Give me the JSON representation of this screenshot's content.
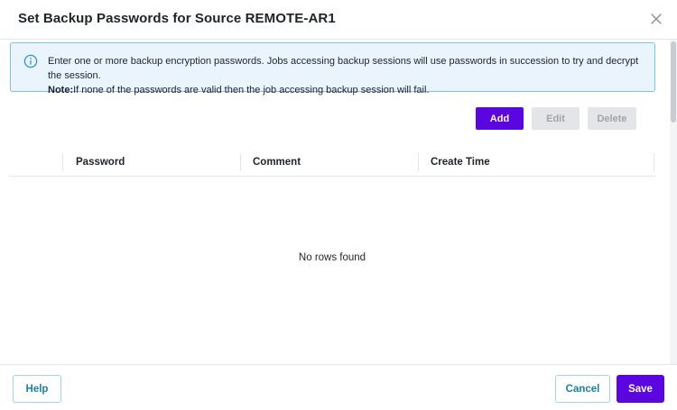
{
  "dialog": {
    "title": "Set Backup Passwords for Source REMOTE-AR1"
  },
  "info": {
    "line1": "Enter one or more backup encryption passwords. Jobs accessing backup sessions will use passwords in succession to try and decrypt the session.",
    "note_label": "Note:",
    "note_text": "If none of the passwords are valid then the job accessing backup session will fail."
  },
  "toolbar": {
    "add_label": "Add",
    "edit_label": "Edit",
    "delete_label": "Delete"
  },
  "table": {
    "columns": [
      "Password",
      "Comment",
      "Create Time"
    ],
    "rows": [],
    "empty_text": "No rows found"
  },
  "footer": {
    "help_label": "Help",
    "cancel_label": "Cancel",
    "save_label": "Save"
  },
  "colors": {
    "primary": "#5b06e0",
    "info_bg": "#e9f4fd",
    "info_border": "#7fc1ef",
    "outline_text": "#1a7fa8"
  },
  "icons": {
    "close": "close-icon",
    "info": "info-circle-icon"
  }
}
